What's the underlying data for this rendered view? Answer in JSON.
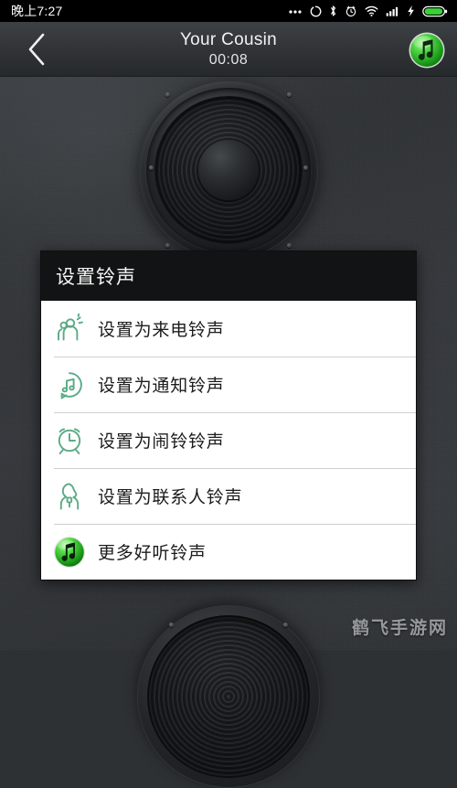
{
  "status_bar": {
    "time": "晚上7:27",
    "icons": [
      {
        "name": "more-dots-icon",
        "glyph": "…"
      },
      {
        "name": "sync-circle-icon",
        "glyph": "◯"
      },
      {
        "name": "bluetooth-icon",
        "glyph": "✱"
      },
      {
        "name": "alarm-clock-icon",
        "glyph": "⏰"
      },
      {
        "name": "wifi-icon",
        "glyph": "📶"
      },
      {
        "name": "cell-signal-icon",
        "glyph": "▂▄▆"
      },
      {
        "name": "charging-bolt-icon",
        "glyph": "⚡"
      },
      {
        "name": "battery-icon",
        "glyph": "▮"
      }
    ],
    "battery_level_percent": 85
  },
  "app_bar": {
    "back_label": "‹",
    "track_title": "Your Cousin",
    "track_time": "00:08",
    "itunes_button_label": "♫"
  },
  "dialog": {
    "title": "设置铃声",
    "items": [
      {
        "icon": "incoming-call-person-icon",
        "label": "设置为来电铃声"
      },
      {
        "icon": "notification-bubble-music-icon",
        "label": "设置为通知铃声"
      },
      {
        "icon": "alarm-clock-icon",
        "label": "设置为闹铃铃声"
      },
      {
        "icon": "contact-person-icon",
        "label": "设置为联系人铃声"
      },
      {
        "icon": "itunes-music-circle-icon",
        "label": "更多好听铃声"
      }
    ]
  },
  "watermark": {
    "text": "鹤飞手游网"
  },
  "colors": {
    "accent_green": "#5aab84",
    "itunes_green": "#35c23a",
    "dialog_header_bg": "#121314",
    "dialog_bg": "#ffffff",
    "status_bar_bg": "#000000",
    "app_bar_text": "#f2f2f2"
  }
}
